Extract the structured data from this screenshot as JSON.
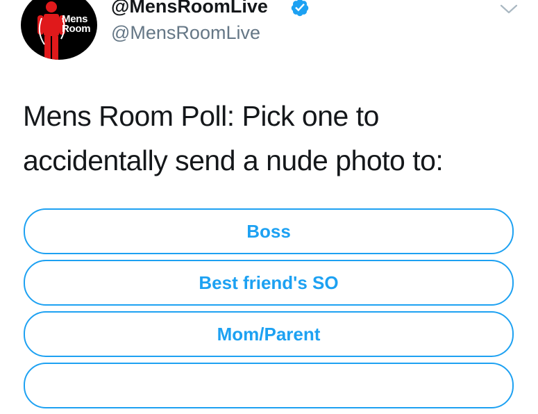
{
  "tweet": {
    "display_name": "@MensRoomLive",
    "handle": "@MensRoomLive",
    "verified": true,
    "avatar": {
      "line1": "Mens",
      "line2": "Room",
      "background": "#000000",
      "figure_color": "#e0191b"
    },
    "text_lines": [
      "Mens Room Poll: Pick one to",
      "accidentally send a nude photo to:"
    ],
    "menu_icon": "chevron-down-icon"
  },
  "poll": {
    "options": [
      {
        "label": "Boss"
      },
      {
        "label": "Best friend's SO"
      },
      {
        "label": "Mom/Parent"
      },
      {
        "label": ""
      }
    ]
  },
  "colors": {
    "accent": "#1da1f2",
    "text": "#14171a",
    "secondary_text": "#657786"
  }
}
